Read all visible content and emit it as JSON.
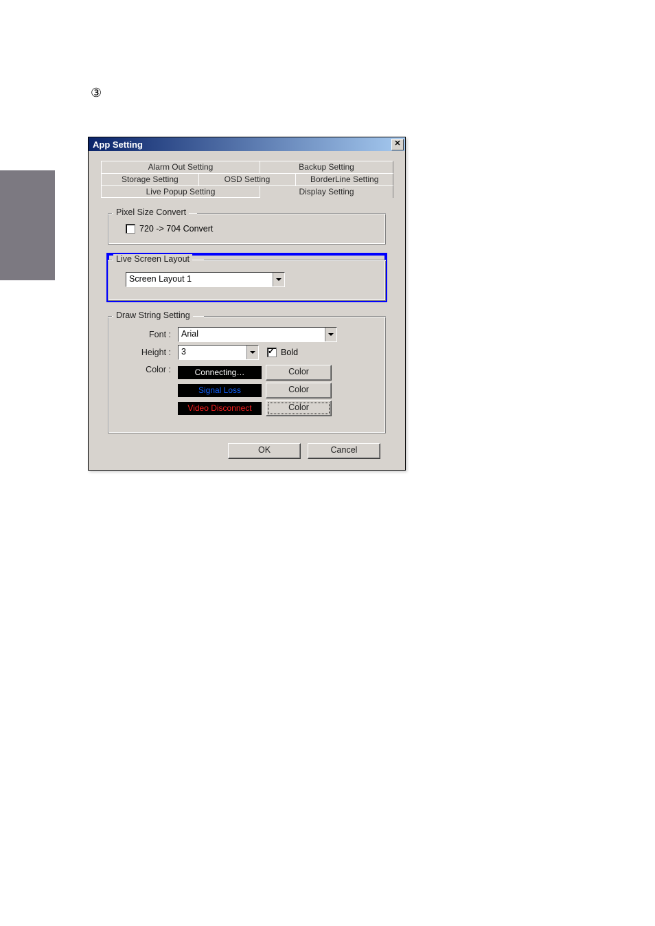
{
  "marker": "③",
  "dialog": {
    "title": "App Setting",
    "tabs": {
      "row1": [
        "Alarm Out Setting",
        "Backup Setting"
      ],
      "row2": [
        "Storage Setting",
        "OSD Setting",
        "BorderLine Setting"
      ],
      "row3": [
        "Live Popup Setting",
        "Display Setting"
      ]
    },
    "active_tab": "Display Setting",
    "groups": {
      "pixel": {
        "title": "Pixel Size Convert",
        "checkbox_label": "720 -> 704 Convert",
        "checkbox_checked": false
      },
      "layout": {
        "title": "Live Screen Layout",
        "combo_value": "Screen Layout 1"
      },
      "drawstring": {
        "title": "Draw String Setting",
        "font_label": "Font :",
        "font_value": "Arial",
        "height_label": "Height :",
        "height_value": "3",
        "bold_label": "Bold",
        "bold_checked": true,
        "color_label": "Color :",
        "statuses": [
          {
            "text": "Connecting…",
            "button": "Color"
          },
          {
            "text": "Signal Loss",
            "button": "Color"
          },
          {
            "text": "Video Disconnect",
            "button": "Color"
          }
        ]
      }
    },
    "footer": {
      "ok": "OK",
      "cancel": "Cancel"
    }
  }
}
